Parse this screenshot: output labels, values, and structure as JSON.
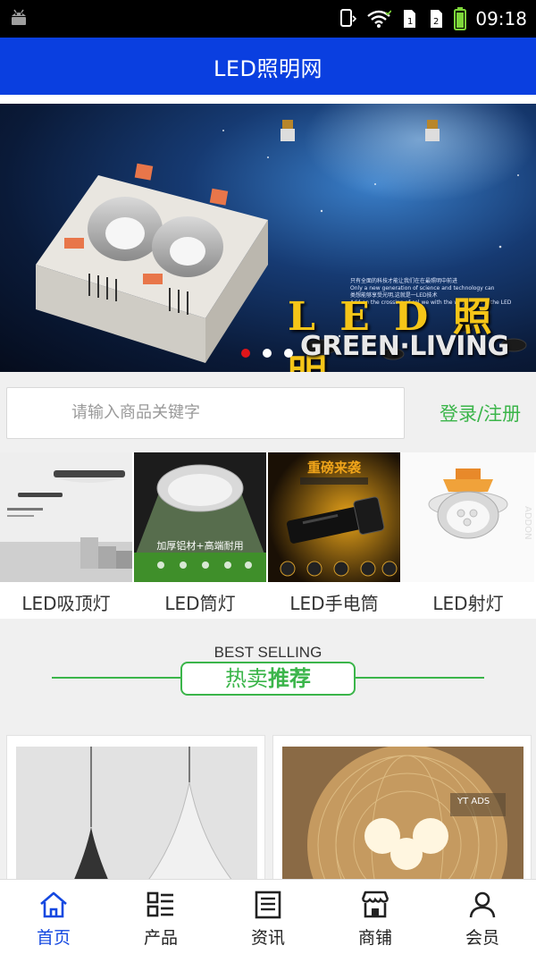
{
  "status_bar": {
    "time": "09:18",
    "icons": [
      "android-icon",
      "vibrate-icon",
      "wifi-icon",
      "sim1-icon",
      "sim2-icon",
      "battery-icon"
    ]
  },
  "app_bar": {
    "title": "LED照明网",
    "color": "#0a3fe0"
  },
  "banner": {
    "headline": "L E D 照明",
    "subheadline": "GREEN·LIVING",
    "small_lines": [
      "只有全面的科技才能让我们在在最照明中前进",
      "Only a new generation of science and technology can",
      "类想能够享受光明,这就是一LED技术",
      "Add on the crossing of sol we with the way Y This is the LED"
    ],
    "carousel": {
      "total": 3,
      "active_index": 0
    }
  },
  "search": {
    "placeholder": "请输入商品关键字",
    "login_label": "登录/注册"
  },
  "categories": [
    {
      "label": "LED吸顶灯",
      "image_text": "",
      "icon": "ceiling-lamp-image"
    },
    {
      "label": "LED筒灯",
      "image_text": "加厚铝材+高端耐用",
      "icon": "downlight-image"
    },
    {
      "label": "LED手电筒",
      "image_text": "重磅来袭",
      "icon": "flashlight-image"
    },
    {
      "label": "LED射灯",
      "image_text": "",
      "icon": "spotlight-image"
    }
  ],
  "best_selling": {
    "en": "BEST SELLING",
    "zh_a": "热卖",
    "zh_b": "推荐"
  },
  "products": [
    {
      "icon": "pendant-lamp-image"
    },
    {
      "icon": "globe-lamp-image",
      "watermark": "YT ADS"
    }
  ],
  "tabs": [
    {
      "label": "首页",
      "icon": "home-icon",
      "active": true
    },
    {
      "label": "产品",
      "icon": "grid-list-icon",
      "active": false
    },
    {
      "label": "资讯",
      "icon": "news-icon",
      "active": false
    },
    {
      "label": "商铺",
      "icon": "store-icon",
      "active": false
    },
    {
      "label": "会员",
      "icon": "user-icon",
      "active": false
    }
  ],
  "colors": {
    "accent_green": "#3bb54a",
    "tab_active": "#1448e0",
    "carousel_active": "#e0151a"
  }
}
